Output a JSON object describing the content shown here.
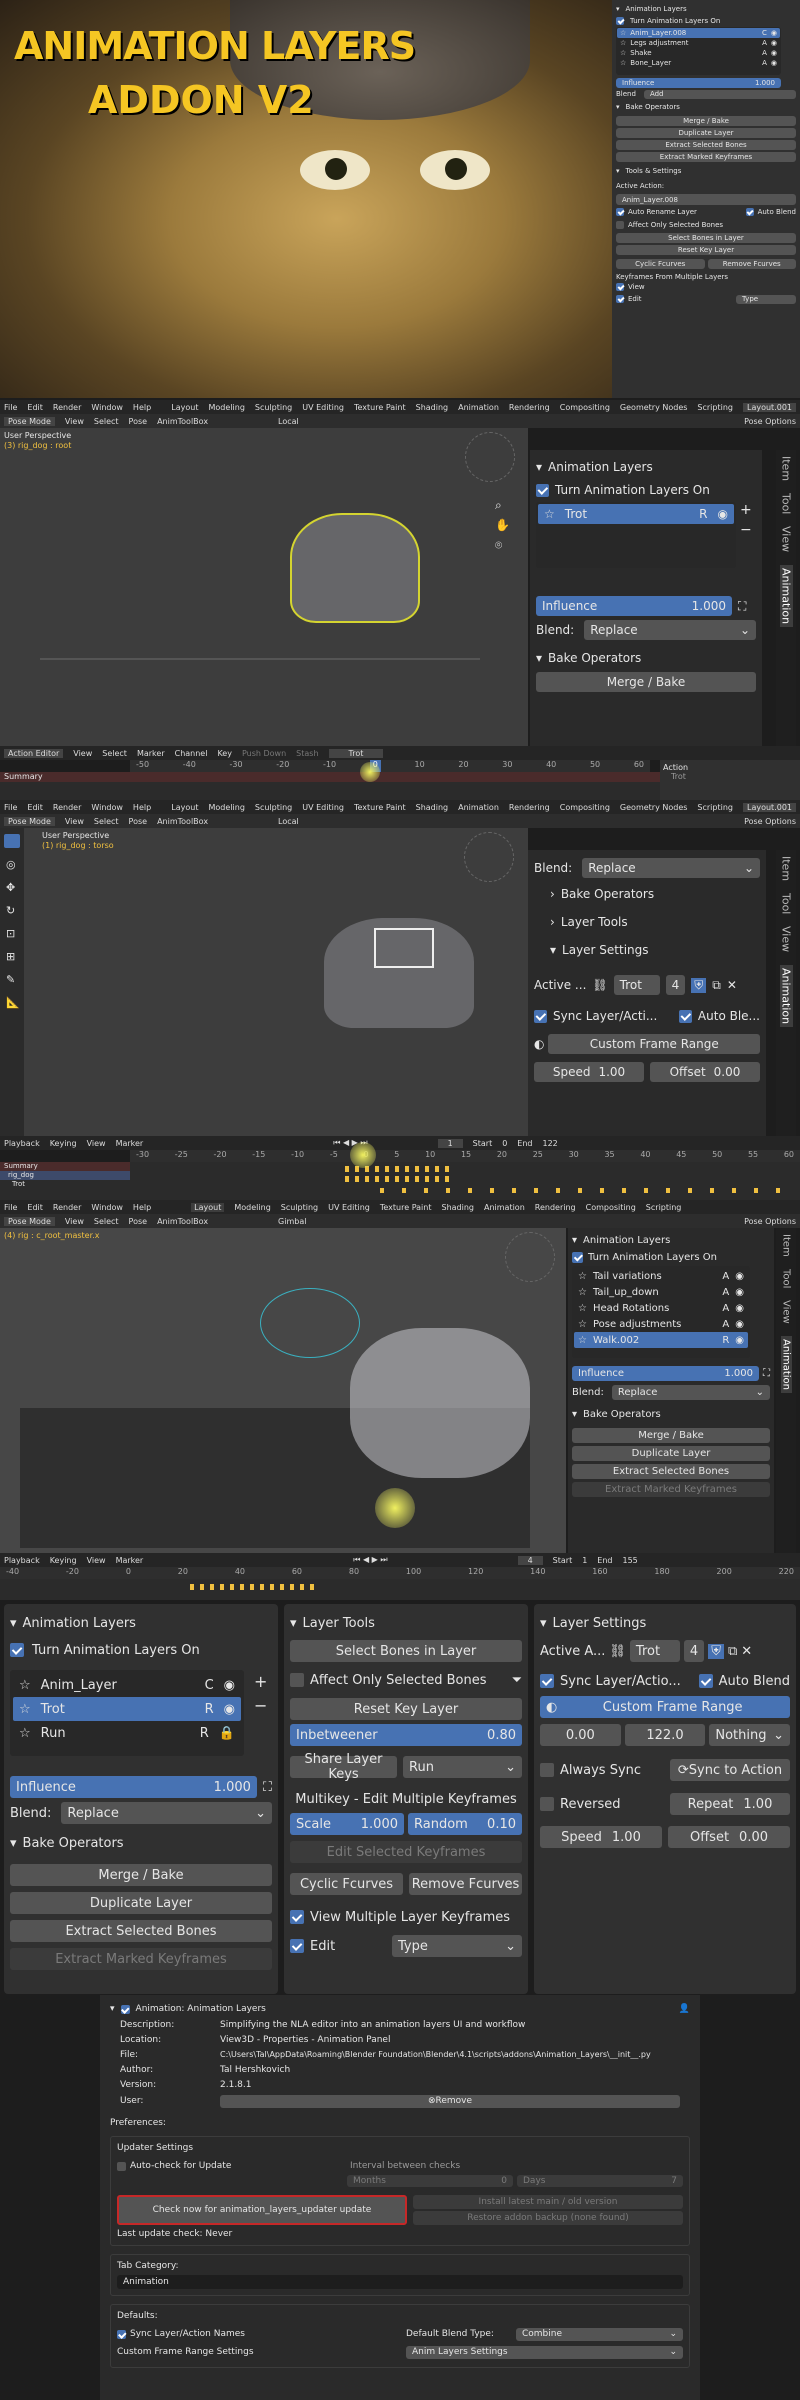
{
  "banner": {
    "title1": "ANIMATION LAYERS",
    "title2": "ADDON V2",
    "panel": {
      "header": "Animation Layers",
      "toggle": "Turn Animation Layers On",
      "layers": [
        {
          "name": "Anim_Layer.008",
          "flag": "C"
        },
        {
          "name": "Legs adjustment",
          "flag": "A"
        },
        {
          "name": "Shake",
          "flag": "A"
        },
        {
          "name": "Bone_Layer",
          "flag": "A"
        }
      ],
      "influence_label": "Influence",
      "influence_value": "1.000",
      "blend_label": "Blend",
      "blend_value": "Add",
      "bake_header": "Bake Operators",
      "merge": "Merge / Bake",
      "duplicate": "Duplicate Layer",
      "extract_sel": "Extract Selected Bones",
      "extract_marked": "Extract Marked Keyframes",
      "tools_header": "Tools & Settings",
      "active_action": "Active Action:",
      "action_value": "Anim_Layer.008",
      "auto_rename": "Auto Rename Layer",
      "auto_blend": "Auto Blend",
      "affect_only": "Affect Only Selected Bones",
      "select_bones": "Select Bones in Layer",
      "reset_key": "Reset Key Layer",
      "cyclic": "Cyclic Fcurves",
      "remove": "Remove Fcurves",
      "kf_multi": "Keyframes From Multiple Layers",
      "view": "View",
      "edit": "Edit",
      "type": "Type"
    }
  },
  "menu": {
    "items": [
      "File",
      "Edit",
      "Render",
      "Window",
      "Help"
    ],
    "workspaces": [
      "Layout",
      "Modeling",
      "Sculpting",
      "UV Editing",
      "Texture Paint",
      "Shading",
      "Animation",
      "Rendering",
      "Compositing",
      "Geometry Nodes",
      "Scripting"
    ],
    "scene": "Layout.001"
  },
  "shot1": {
    "mode": "Pose Mode",
    "view": "View",
    "select": "Select",
    "pose": "Pose",
    "animtoolbox": "AnimToolBox",
    "orient": "Local",
    "pose_options": "Pose Options",
    "vp_title": "User Perspective",
    "vp_sub": "(3) rig_dog : root",
    "panel": {
      "header": "Animation Layers",
      "toggle": "Turn Animation Layers On",
      "layer": "Trot",
      "flag": "R",
      "influence_label": "Influence",
      "influence_value": "1.000",
      "blend_label": "Blend:",
      "blend_value": "Replace",
      "bake": "Bake Operators",
      "merge": "Merge / Bake"
    },
    "tabs": [
      "Item",
      "Tool",
      "View",
      "Animation"
    ],
    "dope": {
      "editor": "Action Editor",
      "view": "View",
      "select": "Select",
      "marker": "Marker",
      "channel": "Channel",
      "key": "Key",
      "push_down": "Push Down",
      "stash": "Stash",
      "action": "Trot",
      "summary": "Summary",
      "action_hdr": "Action",
      "action_sub": "Trot",
      "ticks": [
        "-50",
        "-40",
        "-30",
        "-20",
        "-10",
        "0",
        "10",
        "20",
        "30",
        "40",
        "50",
        "60"
      ]
    }
  },
  "shot2": {
    "mode": "Pose Mode",
    "view": "View",
    "select": "Select",
    "pose": "Pose",
    "animtoolbox": "AnimToolBox",
    "orient": "Local",
    "pose_options": "Pose Options",
    "vp_title": "User Perspective",
    "vp_sub": "(1) rig_dog : torso",
    "panel": {
      "blend_label": "Blend:",
      "blend_value": "Replace",
      "bake": "Bake Operators",
      "layer_tools": "Layer Tools",
      "layer_settings": "Layer Settings",
      "active_label": "Active ...",
      "action": "Trot",
      "users": "4",
      "sync": "Sync Layer/Acti...",
      "auto_blend": "Auto Ble...",
      "custom_range": "Custom Frame Range",
      "speed_label": "Speed",
      "speed_value": "1.00",
      "offset_label": "Offset",
      "offset_value": "0.00"
    },
    "tabs": [
      "Item",
      "Tool",
      "View",
      "Animation"
    ],
    "timeline": {
      "playback": "Playback",
      "keying": "Keying",
      "view": "View",
      "marker": "Marker",
      "frame": "1",
      "start_label": "Start",
      "start": "0",
      "end_label": "End",
      "end": "122",
      "summary": "Summary",
      "rig": "rig_dog",
      "trot": "Trot",
      "ticks": [
        "-30",
        "-25",
        "-20",
        "-15",
        "-10",
        "-5",
        "0",
        "5",
        "10",
        "15",
        "20",
        "25",
        "30",
        "35",
        "40",
        "45",
        "50",
        "55",
        "60"
      ]
    }
  },
  "shot3": {
    "mode": "Pose Mode",
    "view": "View",
    "select": "Select",
    "pose": "Pose",
    "animtoolbox": "AnimToolBox",
    "orient": "Gimbal",
    "pose_options": "Pose Options",
    "vp_sub": "(4) rig : c_root_master.x",
    "panel": {
      "header": "Animation Layers",
      "toggle": "Turn Animation Layers On",
      "layers": [
        {
          "name": "Tail variations",
          "flag": "A"
        },
        {
          "name": "Tail_up_down",
          "flag": "A"
        },
        {
          "name": "Head Rotations",
          "flag": "A"
        },
        {
          "name": "Pose adjustments",
          "flag": "A"
        },
        {
          "name": "Walk.002",
          "flag": "R"
        }
      ],
      "influence_label": "Influence",
      "influence_value": "1.000",
      "blend_label": "Blend:",
      "blend_value": "Replace",
      "bake": "Bake Operators",
      "merge": "Merge / Bake",
      "duplicate": "Duplicate Layer",
      "extract_sel": "Extract Selected Bones",
      "extract_marked": "Extract Marked Keyframes"
    },
    "tabs": [
      "Item",
      "Tool",
      "View",
      "Animation"
    ],
    "timeline": {
      "playback": "Playback",
      "keying": "Keying",
      "view": "View",
      "marker": "Marker",
      "frame": "4",
      "start_label": "Start",
      "start": "1",
      "end_label": "End",
      "end": "155",
      "ticks": [
        "-40",
        "-20",
        "0",
        "20",
        "40",
        "60",
        "80",
        "100",
        "120",
        "140",
        "160",
        "180",
        "200",
        "220"
      ]
    }
  },
  "large": {
    "left": {
      "header": "Animation Layers",
      "toggle": "Turn Animation Layers On",
      "layers": [
        {
          "name": "Anim_Layer",
          "flag": "C"
        },
        {
          "name": "Trot",
          "flag": "R"
        },
        {
          "name": "Run",
          "flag": "R"
        }
      ],
      "influence_label": "Influence",
      "influence_value": "1.000",
      "blend_label": "Blend:",
      "blend_value": "Replace",
      "bake": "Bake Operators",
      "merge": "Merge / Bake",
      "duplicate": "Duplicate Layer",
      "extract_sel": "Extract Selected Bones",
      "extract_marked": "Extract Marked Keyframes"
    },
    "middle": {
      "header": "Layer Tools",
      "select_bones": "Select Bones in Layer",
      "affect_only": "Affect Only Selected Bones",
      "reset_key": "Reset Key Layer",
      "inbetweener": "Inbetweener",
      "inbetweener_value": "0.80",
      "share_keys": "Share Layer Keys",
      "share_value": "Run",
      "multikey": "Multikey - Edit Multiple Keyframes",
      "scale_label": "Scale",
      "scale_value": "1.000",
      "random_label": "Random",
      "random_value": "0.10",
      "edit_selected": "Edit Selected Keyframes",
      "cyclic": "Cyclic Fcurves",
      "remove": "Remove Fcurves",
      "view_multi": "View Multiple Layer Keyframes",
      "edit": "Edit",
      "type": "Type"
    },
    "right": {
      "header": "Layer Settings",
      "active_label": "Active A...",
      "action": "Trot",
      "users": "4",
      "sync": "Sync Layer/Actio...",
      "auto_blend": "Auto Blend",
      "custom_range": "Custom Frame Range",
      "range_start": "0.00",
      "range_end": "122.0",
      "nothing": "Nothing",
      "always_sync": "Always Sync",
      "sync_action": "Sync to Action",
      "reversed": "Reversed",
      "repeat_label": "Repeat",
      "repeat_value": "1.00",
      "speed_label": "Speed",
      "speed_value": "1.00",
      "offset_label": "Offset",
      "offset_value": "0.00"
    }
  },
  "prefs": {
    "addon": "Animation: Animation Layers",
    "rows": [
      {
        "label": "Description:",
        "value": "Simplifying the NLA editor into an animation layers UI and workflow"
      },
      {
        "label": "Location:",
        "value": "View3D - Properties - Animation Panel"
      },
      {
        "label": "File:",
        "value": "C:\\Users\\Tal\\AppData\\Roaming\\Blender Foundation\\Blender\\4.1\\scripts\\addons\\Animation_Layers\\__init__.py"
      },
      {
        "label": "Author:",
        "value": "Tal Hershkovich"
      },
      {
        "label": "Version:",
        "value": "2.1.8.1"
      }
    ],
    "user_label": "User:",
    "remove": "Remove",
    "preferences": "Preferences:",
    "updater": "Updater Settings",
    "auto_check": "Auto-check for Update",
    "interval": "Interval between checks",
    "months": "Months",
    "months_val": "0",
    "days": "Days",
    "days_val": "7",
    "check_now": "Check now for animation_layers_updater update",
    "install_latest": "Install latest main / old version",
    "restore": "Restore addon backup (none found)",
    "last_check": "Last update check: Never",
    "tab_category": "Tab Category:",
    "tab_value": "Animation",
    "defaults": "Defaults:",
    "sync_names": "Sync Layer/Action Names",
    "blend_type_label": "Default Blend Type:",
    "blend_type_value": "Combine",
    "custom_range_label": "Custom Frame Range Settings",
    "custom_range_value": "Anim Layers Settings"
  }
}
